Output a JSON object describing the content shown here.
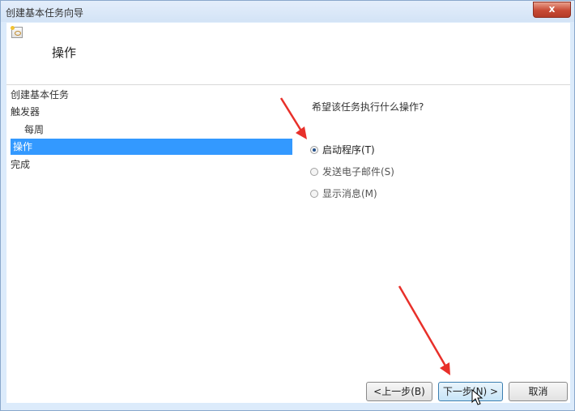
{
  "window": {
    "title": "创建基本任务向导",
    "close_label": "x"
  },
  "header": {
    "title": "操作"
  },
  "steps": [
    {
      "label": "创建基本任务",
      "active": false
    },
    {
      "label": "触发器",
      "active": false
    },
    {
      "label": "每周",
      "active": false,
      "indent": true
    },
    {
      "label": "操作",
      "active": true
    },
    {
      "label": "完成",
      "active": false
    }
  ],
  "question": "希望该任务执行什么操作?",
  "options": [
    {
      "label": "启动程序(T)",
      "checked": true
    },
    {
      "label": "发送电子邮件(S)",
      "checked": false
    },
    {
      "label": "显示消息(M)",
      "checked": false
    }
  ],
  "buttons": {
    "back": "<上一步(B)",
    "next": "下一步(N) >",
    "cancel": "取消"
  },
  "colors": {
    "selection": "#3399ff",
    "annotation_arrow": "#e8302a"
  },
  "icons": {
    "header": "task-scheduler-icon",
    "cursor": "mouse-pointer-icon"
  }
}
